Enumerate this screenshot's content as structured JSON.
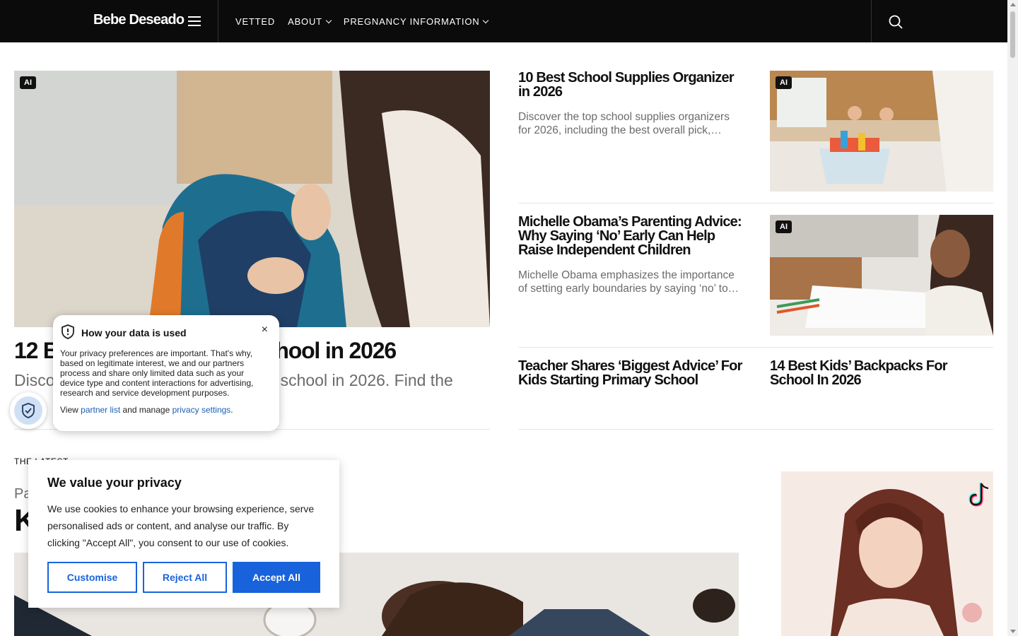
{
  "header": {
    "logo": "Bebe Deseado",
    "nav": [
      {
        "label": "VETTED",
        "dropdown": false
      },
      {
        "label": "ABOUT",
        "dropdown": true
      },
      {
        "label": "PREGNANCY INFORMATION",
        "dropdown": true
      }
    ],
    "icons": [
      "menu-icon",
      "search-icon"
    ]
  },
  "hero": {
    "badge": "AI",
    "title": "12 B",
    "title_end": "chool in 2026",
    "excerpt_start": "Disco",
    "excerpt_end": "r school in 2026. Find the"
  },
  "articles": [
    {
      "title": "10 Best School Supplies Organizer in 2026",
      "excerpt": "Discover the top school supplies organizers for 2026, including the best overall pick,…",
      "badge": "AI"
    },
    {
      "title": "Michelle Obama’s Parenting Advice: Why Saying ‘No’ Early Can Help Raise Independent Children",
      "excerpt": "Michelle Obama emphasizes the importance of setting early boundaries by saying ‘no’ to…",
      "badge": "AI"
    },
    {
      "title": "Teacher Shares ‘Biggest Advice’ For Kids Starting Primary School"
    },
    {
      "title": "14 Best Kids’ Backpacks For School In 2026"
    }
  ],
  "latest": {
    "label": "THE LATEST",
    "partial_kicker": "Pa",
    "partial_title": "K"
  },
  "data_popup": {
    "title": "How your data is used",
    "body": "Your privacy preferences are important. That's why, based on legitimate interest, we and our partners process and share only limited data such as your device type and content interactions for advertising, research and service development purposes.",
    "links_prefix": "View",
    "partner_link": "partner list",
    "links_middle": "and manage",
    "settings_link": "privacy settings",
    "links_suffix": ".",
    "close": "×"
  },
  "cookie_banner": {
    "title": "We value your privacy",
    "text": "We use cookies to enhance your browsing experience, serve personalised ads or content, and analyse our traffic. By clicking \"Accept All\", you consent to our use of cookies.",
    "buttons": {
      "customise": "Customise",
      "reject": "Reject All",
      "accept": "Accept All"
    }
  },
  "colors": {
    "accent": "#1863dc",
    "header_bg": "#0b0b0b",
    "link": "#1a5fb4",
    "muted_text": "#6b6b6b"
  }
}
